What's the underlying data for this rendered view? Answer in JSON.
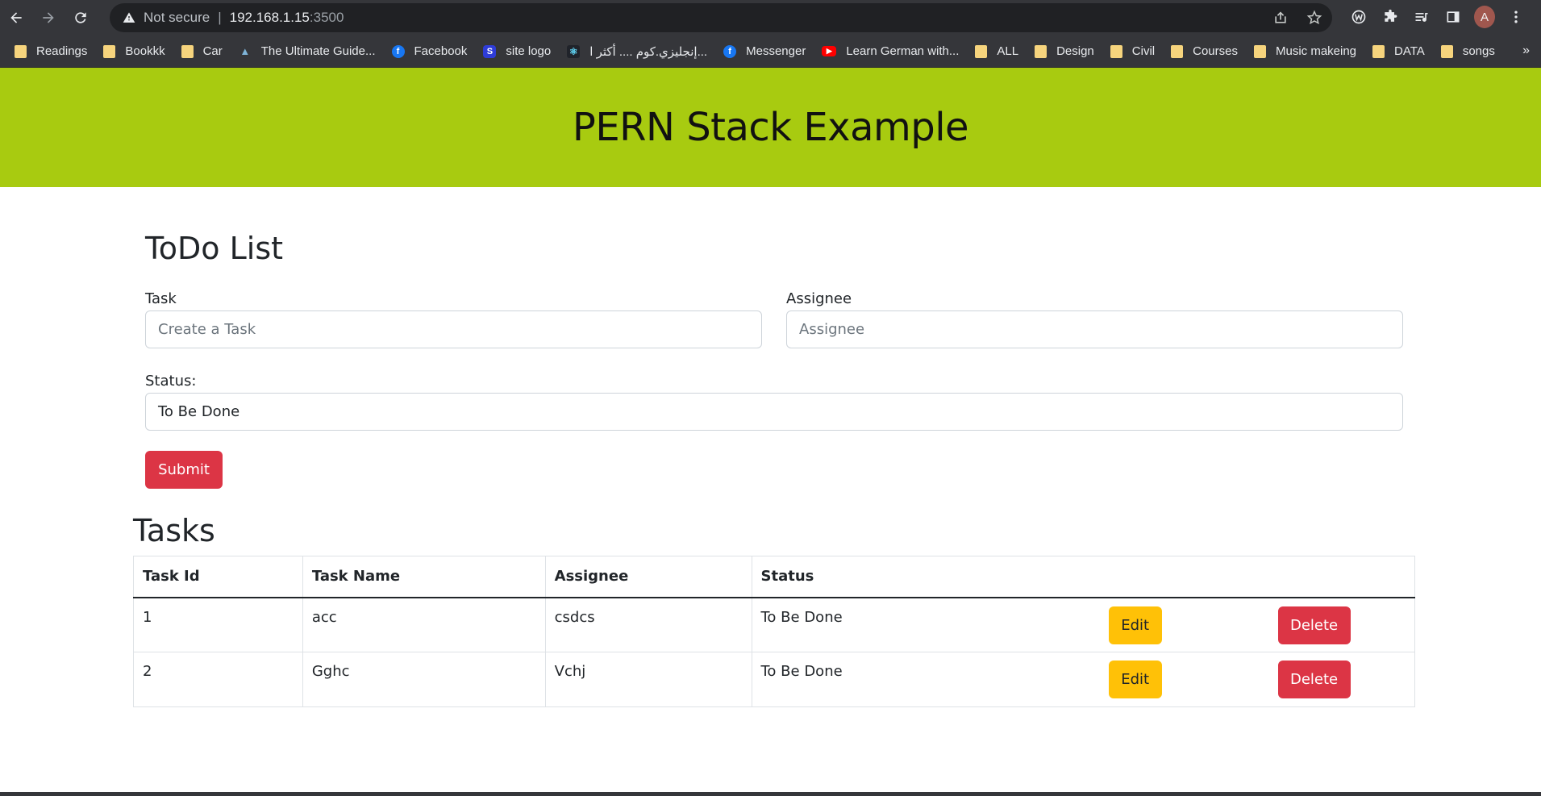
{
  "browser": {
    "security_label": "Not secure",
    "separator": "|",
    "url_host": "192.168.1.15",
    "url_port": ":3500",
    "avatar_letter": "A"
  },
  "bookmarks": [
    {
      "label": "Readings",
      "icon": "folder-icon"
    },
    {
      "label": "Bookkk",
      "icon": "folder-icon"
    },
    {
      "label": "Car",
      "icon": "folder-icon"
    },
    {
      "label": "The Ultimate Guide...",
      "icon": "mountain-icon"
    },
    {
      "label": "Facebook",
      "icon": "facebook-icon"
    },
    {
      "label": "site logo",
      "icon": "site-logo-icon"
    },
    {
      "label": "إنجليزي.كوم .... أكثر ا...",
      "icon": "react-icon"
    },
    {
      "label": "Messenger",
      "icon": "facebook-icon"
    },
    {
      "label": "Learn German with...",
      "icon": "youtube-icon"
    },
    {
      "label": "ALL",
      "icon": "folder-icon"
    },
    {
      "label": "Design",
      "icon": "folder-icon"
    },
    {
      "label": "Civil",
      "icon": "folder-icon"
    },
    {
      "label": "Courses",
      "icon": "folder-icon"
    },
    {
      "label": "Music makeing",
      "icon": "folder-icon"
    },
    {
      "label": "DATA",
      "icon": "folder-icon"
    },
    {
      "label": "songs",
      "icon": "folder-icon"
    }
  ],
  "header": {
    "title": "PERN Stack Example",
    "background": "#a8cb10"
  },
  "form": {
    "title": "ToDo List",
    "task_label": "Task",
    "task_placeholder": "Create a Task",
    "assignee_label": "Assignee",
    "assignee_placeholder": "Assignee",
    "status_label": "Status:",
    "status_value": "To Be Done",
    "submit_label": "Submit"
  },
  "tasks": {
    "title": "Tasks",
    "columns": [
      "Task Id",
      "Task Name",
      "Assignee",
      "Status"
    ],
    "rows": [
      {
        "id": "1",
        "name": "acc",
        "assignee": "csdcs",
        "status": "To Be Done",
        "edit": "Edit",
        "delete": "Delete"
      },
      {
        "id": "2",
        "name": "Gghc",
        "assignee": "Vchj",
        "status": "To Be Done",
        "edit": "Edit",
        "delete": "Delete"
      }
    ]
  },
  "colors": {
    "danger": "#dc3545",
    "warning": "#ffc107"
  }
}
